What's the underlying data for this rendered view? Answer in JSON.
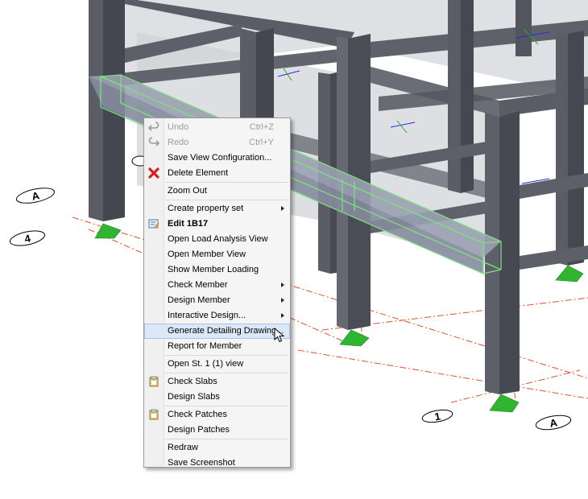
{
  "context_menu": {
    "items": [
      {
        "label": "Undo",
        "shortcut": "Ctrl+Z",
        "icon": "undo-icon",
        "disabled": true
      },
      {
        "label": "Redo",
        "shortcut": "Ctrl+Y",
        "icon": "redo-icon",
        "disabled": true
      },
      {
        "label": "Save View Configuration..."
      },
      {
        "label": "Delete Element",
        "icon": "delete-icon"
      },
      {
        "label": "Zoom Out"
      },
      {
        "label": "Create property set",
        "submenu": true
      },
      {
        "label": "Edit 1B17",
        "icon": "edit-icon",
        "bold": true
      },
      {
        "label": "Open Load Analysis View"
      },
      {
        "label": "Open Member View"
      },
      {
        "label": "Show Member Loading"
      },
      {
        "label": "Check Member",
        "submenu": true
      },
      {
        "label": "Design Member",
        "submenu": true
      },
      {
        "label": "Interactive Design...",
        "submenu": true
      },
      {
        "label": "Generate Detailing Drawing...",
        "hover": true
      },
      {
        "label": "Report for Member"
      },
      {
        "label": "Open St. 1 (1) view"
      },
      {
        "label": "Check Slabs",
        "icon": "clipboard-icon"
      },
      {
        "label": "Design Slabs"
      },
      {
        "label": "Check Patches",
        "icon": "clipboard-icon"
      },
      {
        "label": "Design Patches"
      },
      {
        "label": "Redraw"
      },
      {
        "label": "Save Screenshot"
      }
    ]
  },
  "grid_labels": [
    "A",
    "4",
    "1",
    "A"
  ],
  "colors": {
    "support": "#2fb52f",
    "selection": "#7de07d",
    "gridline": "#e0502a",
    "column": "#4a4c56"
  }
}
